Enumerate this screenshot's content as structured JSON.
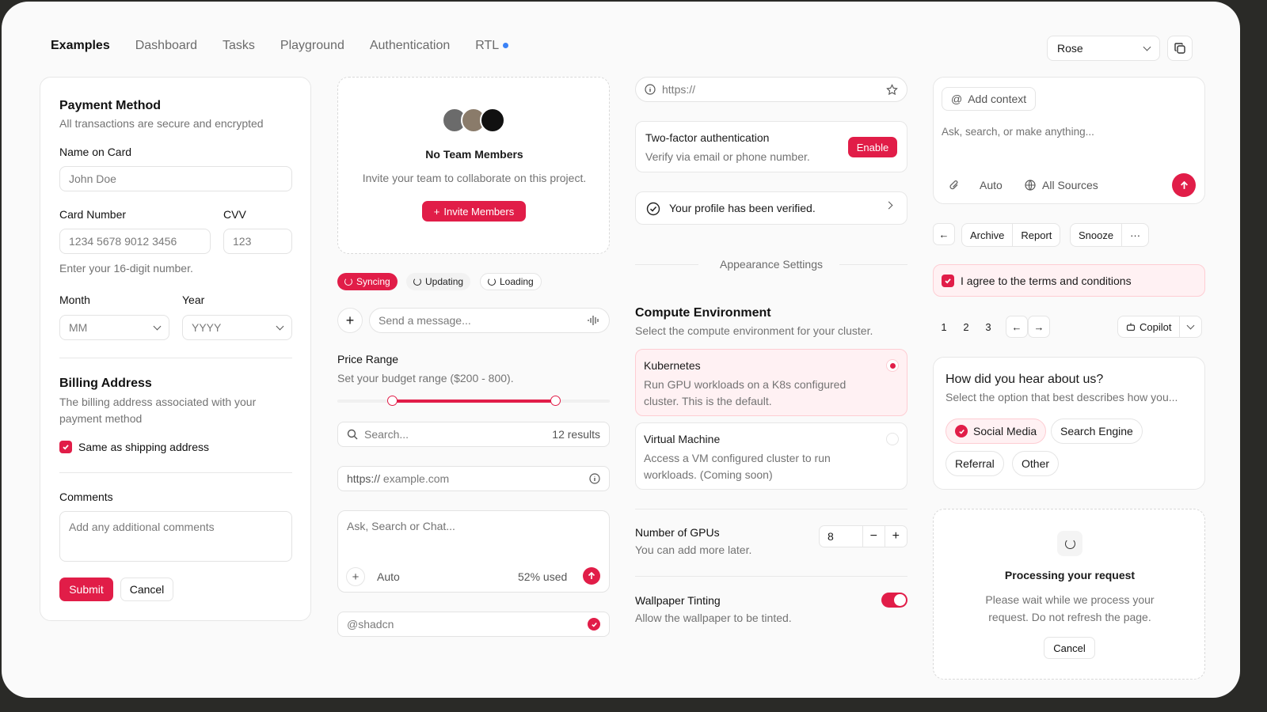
{
  "nav": {
    "items": [
      {
        "label": "Examples",
        "active": true
      },
      {
        "label": "Dashboard",
        "active": false
      },
      {
        "label": "Tasks",
        "active": false
      },
      {
        "label": "Playground",
        "active": false
      },
      {
        "label": "Authentication",
        "active": false
      },
      {
        "label": "RTL",
        "active": false
      }
    ],
    "theme_value": "Rose"
  },
  "payment": {
    "title": "Payment Method",
    "subtitle": "All transactions are secure and encrypted",
    "name_label": "Name on Card",
    "name_placeholder": "John Doe",
    "card_label": "Card Number",
    "card_placeholder": "1234 5678 9012 3456",
    "cvv_label": "CVV",
    "cvv_placeholder": "123",
    "card_hint": "Enter your 16-digit number.",
    "month_label": "Month",
    "month_value": "MM",
    "year_label": "Year",
    "year_value": "YYYY",
    "billing_title": "Billing Address",
    "billing_desc_1": "The billing address associated with your",
    "billing_desc_2": "payment method",
    "same_as_shipping": "Same as shipping address",
    "comments_label": "Comments",
    "comments_placeholder": "Add any additional comments",
    "submit": "Submit",
    "cancel": "Cancel"
  },
  "team": {
    "title": "No Team Members",
    "desc": "Invite your team to collaborate on this project.",
    "invite": "Invite Members"
  },
  "status_pills": [
    "Syncing",
    "Updating",
    "Loading"
  ],
  "message": {
    "placeholder": "Send a message..."
  },
  "price": {
    "title": "Price Range",
    "desc": "Set your budget range ($200 - 800).",
    "low": 200,
    "high": 800
  },
  "search": {
    "placeholder": "Search...",
    "results": "12 results"
  },
  "url_field": {
    "prefix": "https://",
    "placeholder": "example.com"
  },
  "chat_box": {
    "placeholder": "Ask, Search or Chat...",
    "mode": "Auto",
    "usage": "52% used"
  },
  "username": {
    "value": "@shadcn"
  },
  "col3": {
    "url_placeholder": "https://",
    "twofa_title": "Two-factor authentication",
    "twofa_desc": "Verify via email or phone number.",
    "enable": "Enable",
    "verified": "Your profile has been verified.",
    "appearance": "Appearance Settings",
    "compute_title": "Compute Environment",
    "compute_desc": "Select the compute environment for your cluster.",
    "k8s_title": "Kubernetes",
    "k8s_desc_1": "Run GPU workloads on a K8s configured",
    "k8s_desc_2": "cluster. This is the default.",
    "vm_title": "Virtual Machine",
    "vm_desc_1": "Access a VM configured cluster to run",
    "vm_desc_2": "workloads. (Coming soon)",
    "gpus_title": "Number of GPUs",
    "gpus_desc": "You can add more later.",
    "gpus_value": "8",
    "wallpaper_title": "Wallpaper Tinting",
    "wallpaper_desc": "Allow the wallpaper to be tinted."
  },
  "col4": {
    "add_context": "Add context",
    "prompt_placeholder": "Ask, search, or make anything...",
    "auto": "Auto",
    "sources": "All Sources",
    "actions": [
      "Archive",
      "Report",
      "Snooze"
    ],
    "terms": "I agree to the terms and conditions",
    "pages": [
      "1",
      "2",
      "3"
    ],
    "copilot": "Copilot",
    "survey_title": "How did you hear about us?",
    "survey_desc": "Select the option that best describes how you...",
    "options": [
      "Social Media",
      "Search Engine",
      "Referral",
      "Other"
    ],
    "processing_title": "Processing your request",
    "processing_desc_1": "Please wait while we process your",
    "processing_desc_2": "request. Do not refresh the page.",
    "processing_cancel": "Cancel"
  },
  "colors": {
    "accent": "#e11d48",
    "accent_soft": "#fff1f3",
    "info_dot": "#3b82f6"
  }
}
